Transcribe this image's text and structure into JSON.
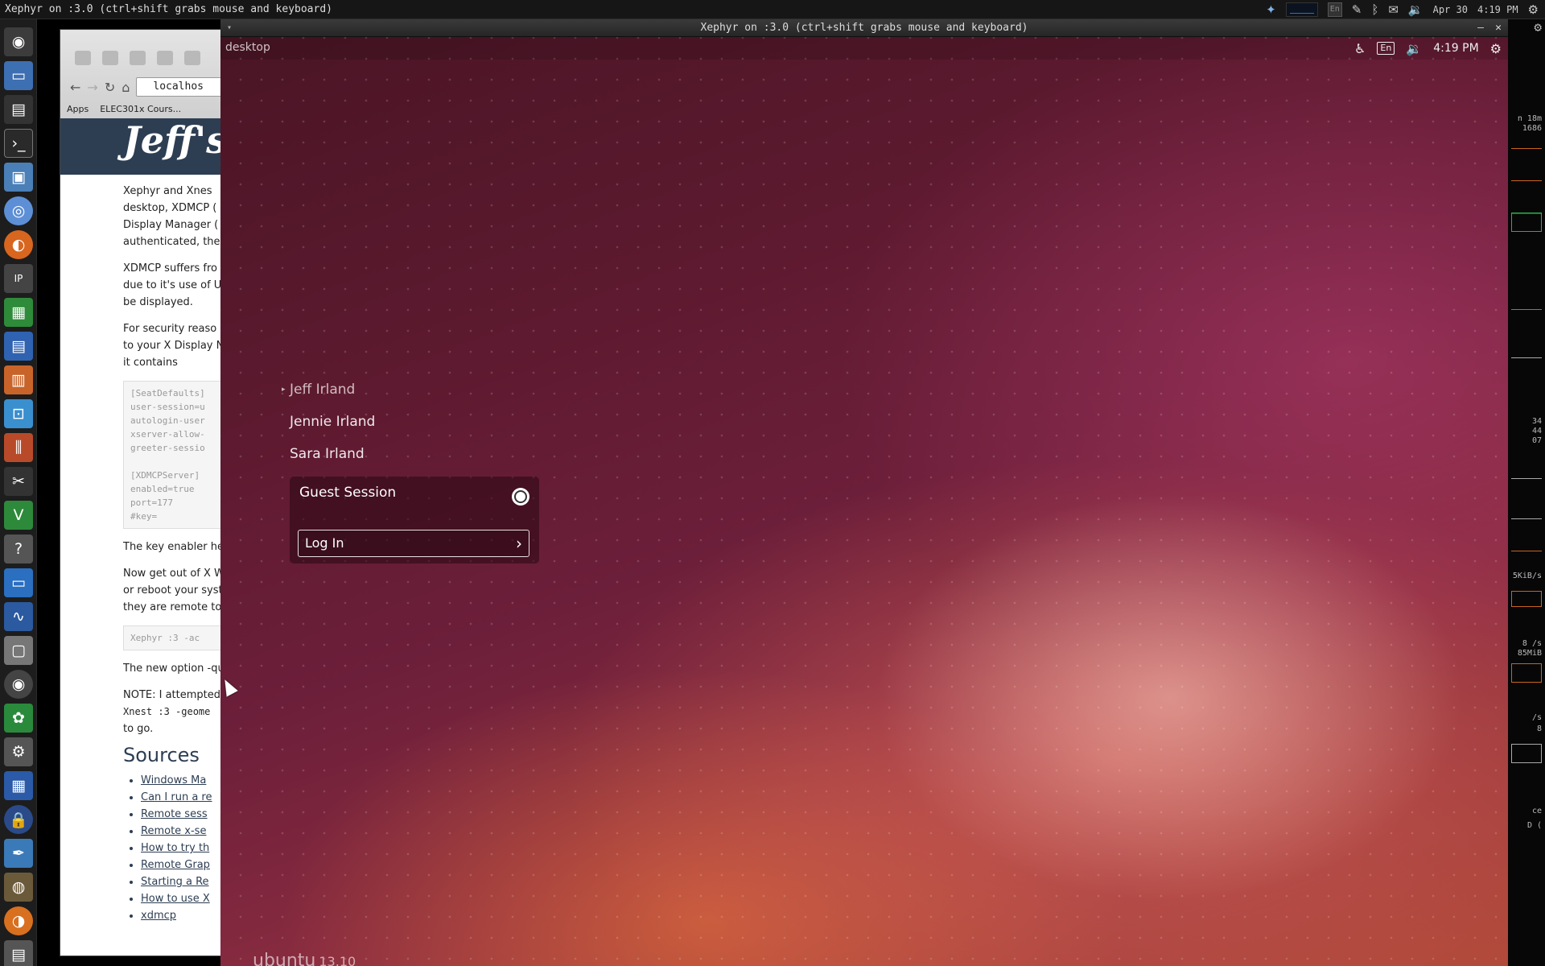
{
  "host": {
    "title": "Xephyr on :3.0 (ctrl+shift grabs mouse and keyboard)",
    "tray": {
      "keyboard_layout": "En",
      "date": "Apr 30",
      "time": "4:19 PM"
    }
  },
  "launcher": {
    "items": [
      "ubuntu-dash-icon",
      "files-icon",
      "monitor-icon",
      "terminal-icon",
      "save-icon",
      "chrome-icon",
      "firefox-icon",
      "ipython-icon",
      "spreadsheet-icon",
      "writer-icon",
      "impress-icon",
      "store-icon",
      "mixer-icon",
      "tools-icon",
      "vim-icon",
      "help-icon",
      "display-icon",
      "system-monitor-icon",
      "disk-icon",
      "cd-icon",
      "palette-icon",
      "settings-icon",
      "calculator-icon",
      "lock-icon",
      "paint-icon",
      "gimp-icon",
      "blender-icon",
      "trash-icon"
    ]
  },
  "browser": {
    "url": "localhos",
    "bookmarks": [
      "Apps",
      "ELEC301x Cours..."
    ],
    "banner_title": "Jeff's",
    "article": {
      "p1": [
        "Xephyr and Xnes",
        "desktop, XDMCP (",
        "Display Manager (",
        "authenticated, the"
      ],
      "p2": [
        "XDMCP suffers fro",
        "due to it's use of U",
        "be displayed."
      ],
      "p3": [
        "For security reaso",
        "to your X Display N",
        "it contains"
      ],
      "code1": "[SeatDefaults]\nuser-session=u\nautologin-user\nxserver-allow-\ngreeter-sessio\n\n[XDMCPServer]\nenabled=true\nport=177\n#key=",
      "p4": "The key enabler he",
      "p5": [
        "Now get out of X W",
        "or reboot your syst",
        "they are remote to"
      ],
      "code2": "Xephyr :3 -ac",
      "p6": "The new option -qu",
      "p7": [
        "NOTE: I attempted",
        "Xnest :3 -geome",
        "to go."
      ],
      "sources_heading": "Sources",
      "sources": [
        "Windows Ma",
        "Can I run a re",
        "Remote sess",
        "Remote x-se",
        "How to try th",
        "Remote Grap",
        "Starting a Re",
        "How to use X",
        "xdmcp"
      ]
    }
  },
  "xephyr": {
    "window_title": "Xephyr on :3.0 (ctrl+shift grabs mouse and keyboard)",
    "greeter": {
      "hostname": "desktop",
      "keyboard_layout": "En",
      "time": "4:19 PM",
      "users": [
        "Jeff Irland",
        "Jennie Irland",
        "Sara Irland"
      ],
      "guest_label": "Guest Session",
      "login_label": "Log In",
      "brand": "ubuntu",
      "version": "13.10"
    }
  },
  "conky": {
    "labels": [
      "n 18m",
      "1686",
      "34",
      "44",
      "07",
      "5KiB/s",
      "8 /s",
      "85MiB",
      "/s",
      "8",
      "ce",
      "D ("
    ]
  }
}
